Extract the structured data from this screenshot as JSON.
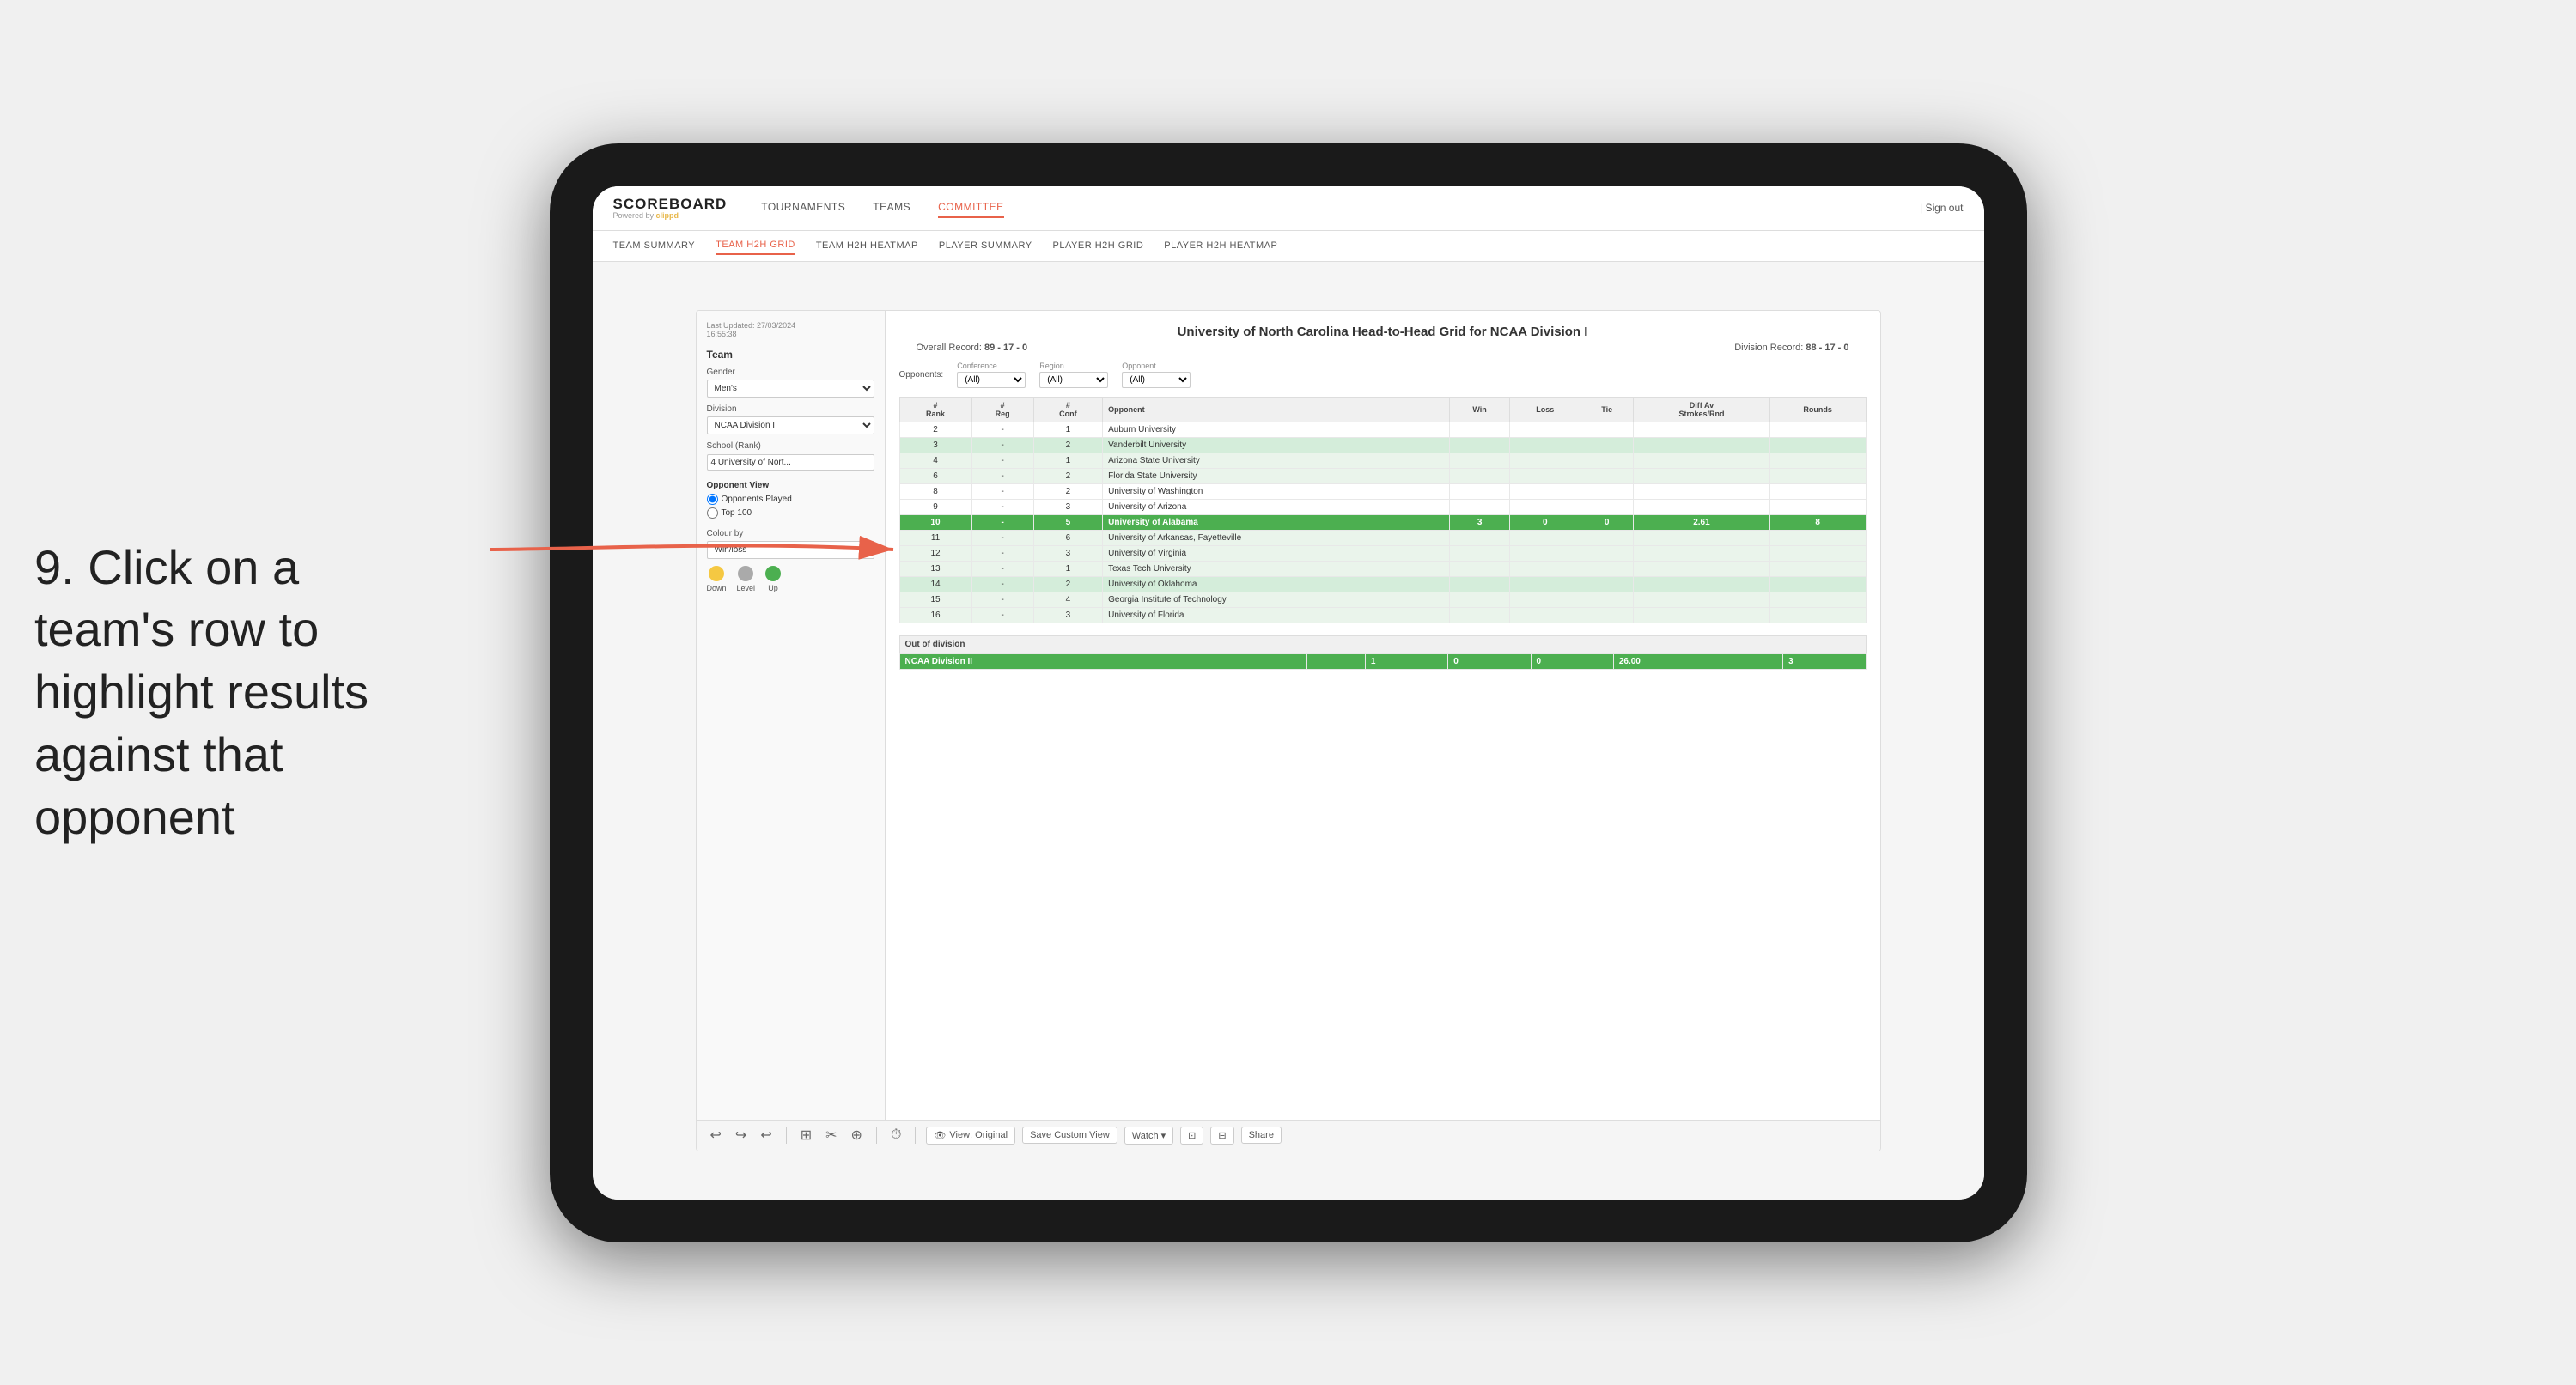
{
  "annotation": {
    "text_line1": "9. Click on a",
    "text_line2": "team's row to",
    "text_line3": "highlight results",
    "text_line4": "against that",
    "text_line5": "opponent"
  },
  "app": {
    "logo": "SCOREBOARD",
    "logo_sub": "Powered by clippd",
    "nav": {
      "items": [
        {
          "label": "TOURNAMENTS",
          "active": false
        },
        {
          "label": "TEAMS",
          "active": false
        },
        {
          "label": "COMMITTEE",
          "active": true
        }
      ],
      "sign_out": "Sign out"
    },
    "sub_nav": {
      "items": [
        {
          "label": "TEAM SUMMARY",
          "active": false
        },
        {
          "label": "TEAM H2H GRID",
          "active": true
        },
        {
          "label": "TEAM H2H HEATMAP",
          "active": false
        },
        {
          "label": "PLAYER SUMMARY",
          "active": false
        },
        {
          "label": "PLAYER H2H GRID",
          "active": false
        },
        {
          "label": "PLAYER H2H HEATMAP",
          "active": false
        }
      ]
    }
  },
  "sidebar": {
    "timestamp_label": "Last Updated: 27/03/2024",
    "timestamp_value": "16:55:38",
    "team_label": "Team",
    "gender_label": "Gender",
    "gender_value": "Men's",
    "division_label": "Division",
    "division_value": "NCAA Division I",
    "school_label": "School (Rank)",
    "school_value": "4 University of Nort...",
    "opponent_view_title": "Opponent View",
    "radio_opponents": "Opponents Played",
    "radio_top100": "Top 100",
    "colour_by_label": "Colour by",
    "colour_by_value": "Win/loss",
    "legend": [
      {
        "label": "Down",
        "color": "yellow"
      },
      {
        "label": "Level",
        "color": "gray"
      },
      {
        "label": "Up",
        "color": "green"
      }
    ]
  },
  "grid": {
    "title": "University of North Carolina Head-to-Head Grid for NCAA Division I",
    "overall_record_label": "Overall Record:",
    "overall_record_value": "89 - 17 - 0",
    "division_record_label": "Division Record:",
    "division_record_value": "88 - 17 - 0",
    "filters": {
      "conference_label": "Conference",
      "conference_value": "(All)",
      "region_label": "Region",
      "region_value": "(All)",
      "opponent_label": "Opponent",
      "opponent_value": "(All)",
      "opponents_label": "Opponents:"
    },
    "table_headers": [
      "#Rank",
      "#Reg",
      "#Conf",
      "Opponent",
      "Win",
      "Loss",
      "Tie",
      "Diff Av Strokes/Rnd",
      "Rounds"
    ],
    "rows": [
      {
        "rank": "2",
        "reg": "-",
        "conf": "1",
        "opponent": "Auburn University",
        "win": "",
        "loss": "",
        "tie": "",
        "diff": "",
        "rounds": "",
        "style": "normal"
      },
      {
        "rank": "3",
        "reg": "-",
        "conf": "2",
        "opponent": "Vanderbilt University",
        "win": "",
        "loss": "",
        "tie": "",
        "diff": "",
        "rounds": "",
        "style": "light-green"
      },
      {
        "rank": "4",
        "reg": "-",
        "conf": "1",
        "opponent": "Arizona State University",
        "win": "",
        "loss": "",
        "tie": "",
        "diff": "",
        "rounds": "",
        "style": "very-light-green"
      },
      {
        "rank": "6",
        "reg": "-",
        "conf": "2",
        "opponent": "Florida State University",
        "win": "",
        "loss": "",
        "tie": "",
        "diff": "",
        "rounds": "",
        "style": "very-light-green"
      },
      {
        "rank": "8",
        "reg": "-",
        "conf": "2",
        "opponent": "University of Washington",
        "win": "",
        "loss": "",
        "tie": "",
        "diff": "",
        "rounds": "",
        "style": "normal"
      },
      {
        "rank": "9",
        "reg": "-",
        "conf": "3",
        "opponent": "University of Arizona",
        "win": "",
        "loss": "",
        "tie": "",
        "diff": "",
        "rounds": "",
        "style": "normal"
      },
      {
        "rank": "10",
        "reg": "-",
        "conf": "5",
        "opponent": "University of Alabama",
        "win": "3",
        "loss": "0",
        "tie": "0",
        "diff": "2.61",
        "rounds": "8",
        "style": "highlighted"
      },
      {
        "rank": "11",
        "reg": "-",
        "conf": "6",
        "opponent": "University of Arkansas, Fayetteville",
        "win": "",
        "loss": "",
        "tie": "",
        "diff": "",
        "rounds": "",
        "style": "very-light-green"
      },
      {
        "rank": "12",
        "reg": "-",
        "conf": "3",
        "opponent": "University of Virginia",
        "win": "",
        "loss": "",
        "tie": "",
        "diff": "",
        "rounds": "",
        "style": "very-light-green"
      },
      {
        "rank": "13",
        "reg": "-",
        "conf": "1",
        "opponent": "Texas Tech University",
        "win": "",
        "loss": "",
        "tie": "",
        "diff": "",
        "rounds": "",
        "style": "very-light-green"
      },
      {
        "rank": "14",
        "reg": "-",
        "conf": "2",
        "opponent": "University of Oklahoma",
        "win": "",
        "loss": "",
        "tie": "",
        "diff": "",
        "rounds": "",
        "style": "light-green"
      },
      {
        "rank": "15",
        "reg": "-",
        "conf": "4",
        "opponent": "Georgia Institute of Technology",
        "win": "",
        "loss": "",
        "tie": "",
        "diff": "",
        "rounds": "",
        "style": "very-light-green"
      },
      {
        "rank": "16",
        "reg": "-",
        "conf": "3",
        "opponent": "University of Florida",
        "win": "",
        "loss": "",
        "tie": "",
        "diff": "",
        "rounds": "",
        "style": "very-light-green"
      }
    ],
    "out_of_division_label": "Out of division",
    "ncaa_division_row": {
      "label": "NCAA Division II",
      "win": "1",
      "loss": "0",
      "tie": "0",
      "diff": "26.00",
      "rounds": "3"
    }
  },
  "toolbar": {
    "buttons": [
      "↩",
      "↪",
      "↩",
      "⊞",
      "✂",
      "⊕",
      "⏱"
    ],
    "view_label": "View: Original",
    "save_custom_label": "Save Custom View",
    "watch_label": "Watch ▾",
    "icon1": "⊡",
    "icon2": "⊟",
    "share_label": "Share"
  }
}
